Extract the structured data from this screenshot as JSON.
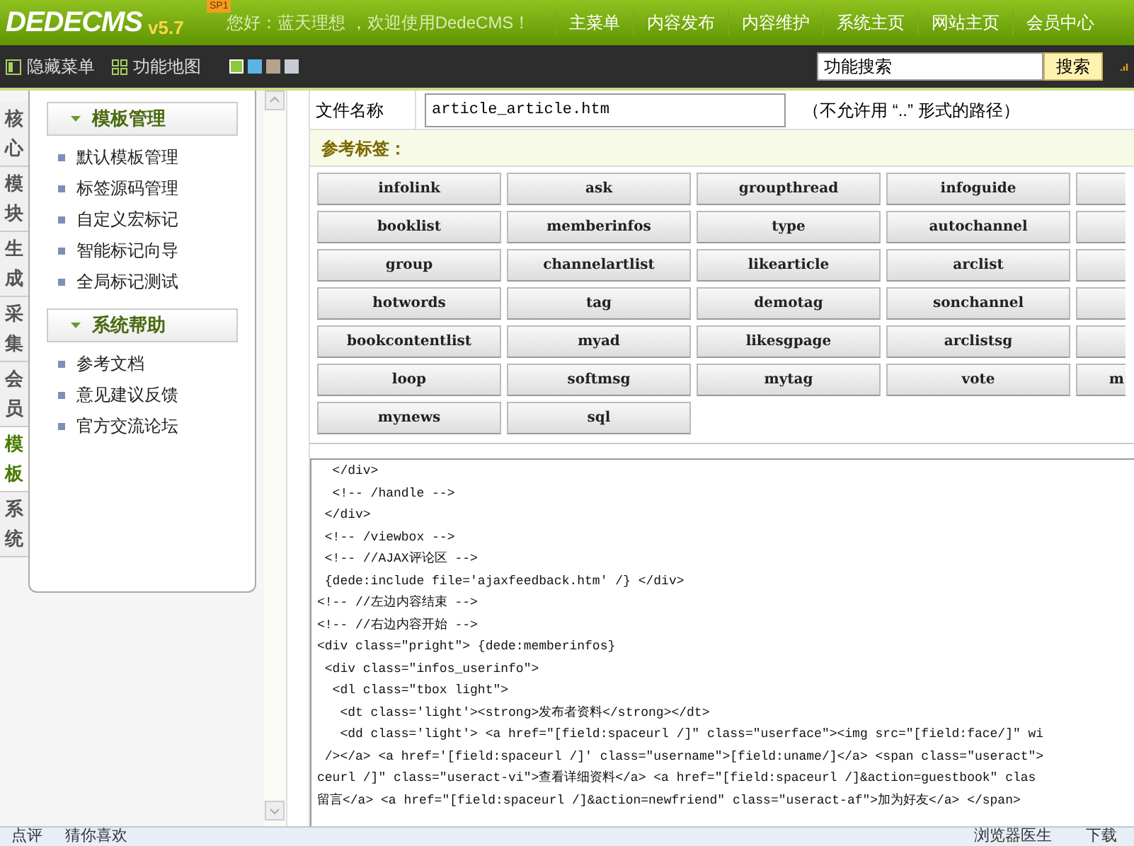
{
  "header": {
    "logo": "DEDECMS",
    "version": "v5.7",
    "badge": "SP1",
    "greeting": "您好：蓝天理想 ，欢迎使用DedeCMS！",
    "nav": [
      "主菜单",
      "内容发布",
      "内容维护",
      "系统主页",
      "网站主页",
      "会员中心"
    ]
  },
  "toolbar": {
    "buttons": [
      "隐藏菜单",
      "功能地图"
    ],
    "swatches": [
      {
        "color": "#8cc83c",
        "selected": true
      },
      {
        "color": "#5cb4e4",
        "selected": false
      },
      {
        "color": "#b4a48c",
        "selected": false
      },
      {
        "color": "#c8ccd4",
        "selected": false
      }
    ],
    "search": {
      "value": "功能搜索",
      "button": "搜索"
    }
  },
  "side_tabs": [
    {
      "label": "核心",
      "selected": false
    },
    {
      "label": "模块",
      "selected": false
    },
    {
      "label": "生成",
      "selected": false
    },
    {
      "label": "采集",
      "selected": false
    },
    {
      "label": "会员",
      "selected": false
    },
    {
      "label": "模板",
      "selected": true
    },
    {
      "label": "系统",
      "selected": false
    }
  ],
  "sidebar": [
    {
      "title": "模板管理",
      "items": [
        "默认模板管理",
        "标签源码管理",
        "自定义宏标记",
        "智能标记向导",
        "全局标记测试"
      ]
    },
    {
      "title": "系统帮助",
      "items": [
        "参考文档",
        "意见建议反馈",
        "官方交流论坛"
      ]
    }
  ],
  "file": {
    "label": "文件名称",
    "value": "article_article.htm",
    "note": "（不允许用 “..” 形式的路径）"
  },
  "reference": {
    "title": "参考标签：",
    "tags": [
      {
        "label": "infolink"
      },
      {
        "label": "ask"
      },
      {
        "label": "groupthread"
      },
      {
        "label": "infoguide"
      },
      {
        "cut": true
      },
      {
        "label": "booklist"
      },
      {
        "label": "memberinfos"
      },
      {
        "label": "type"
      },
      {
        "label": "autochannel"
      },
      {
        "cut": true
      },
      {
        "label": "group"
      },
      {
        "label": "channelartlist"
      },
      {
        "label": "likearticle"
      },
      {
        "label": "arclist"
      },
      {
        "cut": true
      },
      {
        "label": "hotwords"
      },
      {
        "label": "tag"
      },
      {
        "label": "demotag"
      },
      {
        "label": "sonchannel"
      },
      {
        "cut": true
      },
      {
        "label": "bookcontentlist"
      },
      {
        "label": "myad"
      },
      {
        "label": "likesgpage"
      },
      {
        "label": "arclistsg"
      },
      {
        "cut": true
      },
      {
        "label": "loop"
      },
      {
        "label": "softmsg"
      },
      {
        "label": "mytag"
      },
      {
        "label": "vote"
      },
      {
        "cut": true,
        "label": "m"
      },
      {
        "label": "mynews"
      },
      {
        "label": "sql"
      }
    ]
  },
  "code": [
    "  </div>",
    "  <!-- /handle -->",
    " </div>",
    " <!-- /viewbox -->",
    " <!-- //AJAX评论区 -->",
    " {dede:include file='ajaxfeedback.htm' /} </div>",
    "<!-- //左边内容结束 -->",
    "<!-- //右边内容开始 -->",
    "<div class=\"pright\"> {dede:memberinfos}",
    " <div class=\"infos_userinfo\">",
    "  <dl class=\"tbox light\">",
    "   <dt class='light'><strong>发布者资料</strong></dt>",
    "   <dd class='light'> <a href=\"[field:spaceurl /]\" class=\"userface\"><img src=\"[field:face/]\" wi",
    " /></a> <a href='[field:spaceurl /]' class=\"username\">[field:uname/]</a> <span class=\"useract\">",
    "ceurl /]\" class=\"useract-vi\">查看详细资料</a> <a href=\"[field:spaceurl /]&action=guestbook\" clas",
    "留言</a> <a href=\"[field:spaceurl /]&action=newfriend\" class=\"useract-af\">加为好友</a> </span>"
  ],
  "status_bar": {
    "left": [
      "点评",
      "猜你喜欢"
    ],
    "right": [
      "浏览器医生",
      "下载"
    ]
  }
}
